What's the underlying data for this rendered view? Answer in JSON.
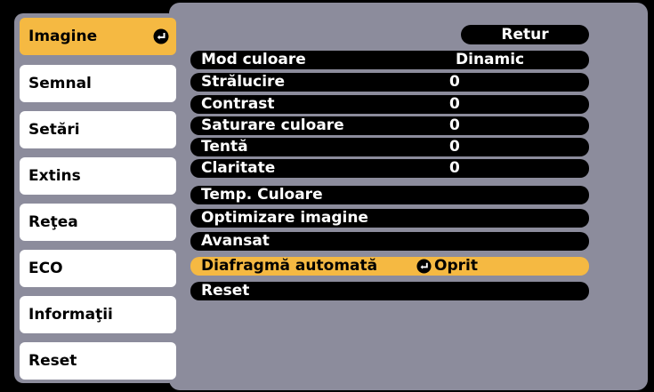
{
  "sidebar": {
    "items": [
      {
        "label": "Imagine",
        "active": true
      },
      {
        "label": "Semnal",
        "active": false
      },
      {
        "label": "Setări",
        "active": false
      },
      {
        "label": "Extins",
        "active": false
      },
      {
        "label": "Reţea",
        "active": false
      },
      {
        "label": "ECO",
        "active": false
      },
      {
        "label": "Informaţii",
        "active": false
      },
      {
        "label": "Reset",
        "active": false
      }
    ]
  },
  "menu": {
    "back_label": "Retur",
    "rows": [
      {
        "label": "Mod culoare",
        "value": "Dinamic"
      },
      {
        "label": "Strălucire",
        "value": "0"
      },
      {
        "label": "Contrast",
        "value": "0"
      },
      {
        "label": "Saturare culoare",
        "value": "0"
      },
      {
        "label": "Tentă",
        "value": "0"
      },
      {
        "label": "Claritate",
        "value": "0"
      },
      {
        "label": "Temp. Culoare",
        "value": ""
      },
      {
        "label": "Optimizare imagine",
        "value": ""
      },
      {
        "label": "Avansat",
        "value": ""
      },
      {
        "label": "Diafragmă automată",
        "value": "Oprit",
        "selected": true
      },
      {
        "label": "Reset",
        "value": ""
      }
    ]
  },
  "colors": {
    "highlight": "#f5b942",
    "panel": "#8c8c9c",
    "background": "#000000"
  }
}
